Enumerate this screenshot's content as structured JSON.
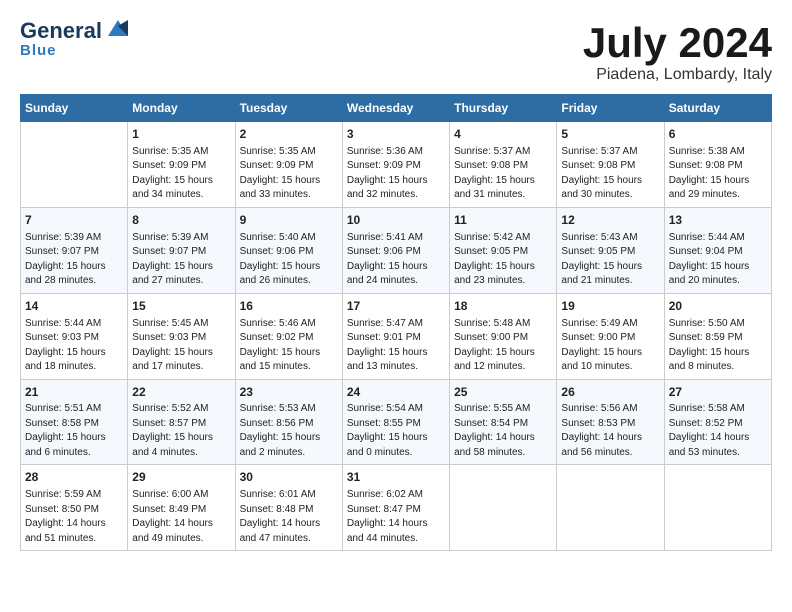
{
  "header": {
    "logo_line1": "General",
    "logo_line2": "Blue",
    "month": "July 2024",
    "location": "Piadena, Lombardy, Italy"
  },
  "days_of_week": [
    "Sunday",
    "Monday",
    "Tuesday",
    "Wednesday",
    "Thursday",
    "Friday",
    "Saturday"
  ],
  "weeks": [
    [
      {
        "day": "",
        "info": ""
      },
      {
        "day": "1",
        "info": "Sunrise: 5:35 AM\nSunset: 9:09 PM\nDaylight: 15 hours\nand 34 minutes."
      },
      {
        "day": "2",
        "info": "Sunrise: 5:35 AM\nSunset: 9:09 PM\nDaylight: 15 hours\nand 33 minutes."
      },
      {
        "day": "3",
        "info": "Sunrise: 5:36 AM\nSunset: 9:09 PM\nDaylight: 15 hours\nand 32 minutes."
      },
      {
        "day": "4",
        "info": "Sunrise: 5:37 AM\nSunset: 9:08 PM\nDaylight: 15 hours\nand 31 minutes."
      },
      {
        "day": "5",
        "info": "Sunrise: 5:37 AM\nSunset: 9:08 PM\nDaylight: 15 hours\nand 30 minutes."
      },
      {
        "day": "6",
        "info": "Sunrise: 5:38 AM\nSunset: 9:08 PM\nDaylight: 15 hours\nand 29 minutes."
      }
    ],
    [
      {
        "day": "7",
        "info": "Sunrise: 5:39 AM\nSunset: 9:07 PM\nDaylight: 15 hours\nand 28 minutes."
      },
      {
        "day": "8",
        "info": "Sunrise: 5:39 AM\nSunset: 9:07 PM\nDaylight: 15 hours\nand 27 minutes."
      },
      {
        "day": "9",
        "info": "Sunrise: 5:40 AM\nSunset: 9:06 PM\nDaylight: 15 hours\nand 26 minutes."
      },
      {
        "day": "10",
        "info": "Sunrise: 5:41 AM\nSunset: 9:06 PM\nDaylight: 15 hours\nand 24 minutes."
      },
      {
        "day": "11",
        "info": "Sunrise: 5:42 AM\nSunset: 9:05 PM\nDaylight: 15 hours\nand 23 minutes."
      },
      {
        "day": "12",
        "info": "Sunrise: 5:43 AM\nSunset: 9:05 PM\nDaylight: 15 hours\nand 21 minutes."
      },
      {
        "day": "13",
        "info": "Sunrise: 5:44 AM\nSunset: 9:04 PM\nDaylight: 15 hours\nand 20 minutes."
      }
    ],
    [
      {
        "day": "14",
        "info": "Sunrise: 5:44 AM\nSunset: 9:03 PM\nDaylight: 15 hours\nand 18 minutes."
      },
      {
        "day": "15",
        "info": "Sunrise: 5:45 AM\nSunset: 9:03 PM\nDaylight: 15 hours\nand 17 minutes."
      },
      {
        "day": "16",
        "info": "Sunrise: 5:46 AM\nSunset: 9:02 PM\nDaylight: 15 hours\nand 15 minutes."
      },
      {
        "day": "17",
        "info": "Sunrise: 5:47 AM\nSunset: 9:01 PM\nDaylight: 15 hours\nand 13 minutes."
      },
      {
        "day": "18",
        "info": "Sunrise: 5:48 AM\nSunset: 9:00 PM\nDaylight: 15 hours\nand 12 minutes."
      },
      {
        "day": "19",
        "info": "Sunrise: 5:49 AM\nSunset: 9:00 PM\nDaylight: 15 hours\nand 10 minutes."
      },
      {
        "day": "20",
        "info": "Sunrise: 5:50 AM\nSunset: 8:59 PM\nDaylight: 15 hours\nand 8 minutes."
      }
    ],
    [
      {
        "day": "21",
        "info": "Sunrise: 5:51 AM\nSunset: 8:58 PM\nDaylight: 15 hours\nand 6 minutes."
      },
      {
        "day": "22",
        "info": "Sunrise: 5:52 AM\nSunset: 8:57 PM\nDaylight: 15 hours\nand 4 minutes."
      },
      {
        "day": "23",
        "info": "Sunrise: 5:53 AM\nSunset: 8:56 PM\nDaylight: 15 hours\nand 2 minutes."
      },
      {
        "day": "24",
        "info": "Sunrise: 5:54 AM\nSunset: 8:55 PM\nDaylight: 15 hours\nand 0 minutes."
      },
      {
        "day": "25",
        "info": "Sunrise: 5:55 AM\nSunset: 8:54 PM\nDaylight: 14 hours\nand 58 minutes."
      },
      {
        "day": "26",
        "info": "Sunrise: 5:56 AM\nSunset: 8:53 PM\nDaylight: 14 hours\nand 56 minutes."
      },
      {
        "day": "27",
        "info": "Sunrise: 5:58 AM\nSunset: 8:52 PM\nDaylight: 14 hours\nand 53 minutes."
      }
    ],
    [
      {
        "day": "28",
        "info": "Sunrise: 5:59 AM\nSunset: 8:50 PM\nDaylight: 14 hours\nand 51 minutes."
      },
      {
        "day": "29",
        "info": "Sunrise: 6:00 AM\nSunset: 8:49 PM\nDaylight: 14 hours\nand 49 minutes."
      },
      {
        "day": "30",
        "info": "Sunrise: 6:01 AM\nSunset: 8:48 PM\nDaylight: 14 hours\nand 47 minutes."
      },
      {
        "day": "31",
        "info": "Sunrise: 6:02 AM\nSunset: 8:47 PM\nDaylight: 14 hours\nand 44 minutes."
      },
      {
        "day": "",
        "info": ""
      },
      {
        "day": "",
        "info": ""
      },
      {
        "day": "",
        "info": ""
      }
    ]
  ]
}
